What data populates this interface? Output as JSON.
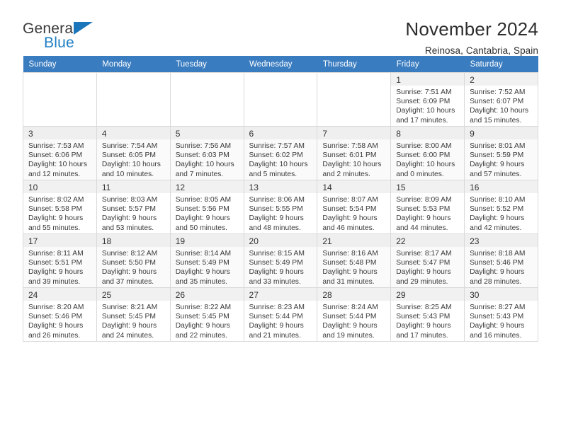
{
  "brand": {
    "name_part1": "General",
    "name_part2": "Blue",
    "accent_color": "#1b75bb"
  },
  "header": {
    "title": "November 2024",
    "subtitle": "Reinosa, Cantabria, Spain"
  },
  "calendar": {
    "header_bg": "#3a7cc0",
    "weekdays": [
      "Sunday",
      "Monday",
      "Tuesday",
      "Wednesday",
      "Thursday",
      "Friday",
      "Saturday"
    ],
    "weeks": [
      [
        {
          "day": "",
          "sunrise": "",
          "sunset": "",
          "daylight1": "",
          "daylight2": ""
        },
        {
          "day": "",
          "sunrise": "",
          "sunset": "",
          "daylight1": "",
          "daylight2": ""
        },
        {
          "day": "",
          "sunrise": "",
          "sunset": "",
          "daylight1": "",
          "daylight2": ""
        },
        {
          "day": "",
          "sunrise": "",
          "sunset": "",
          "daylight1": "",
          "daylight2": ""
        },
        {
          "day": "",
          "sunrise": "",
          "sunset": "",
          "daylight1": "",
          "daylight2": ""
        },
        {
          "day": "1",
          "sunrise": "Sunrise: 7:51 AM",
          "sunset": "Sunset: 6:09 PM",
          "daylight1": "Daylight: 10 hours",
          "daylight2": "and 17 minutes."
        },
        {
          "day": "2",
          "sunrise": "Sunrise: 7:52 AM",
          "sunset": "Sunset: 6:07 PM",
          "daylight1": "Daylight: 10 hours",
          "daylight2": "and 15 minutes."
        }
      ],
      [
        {
          "day": "3",
          "sunrise": "Sunrise: 7:53 AM",
          "sunset": "Sunset: 6:06 PM",
          "daylight1": "Daylight: 10 hours",
          "daylight2": "and 12 minutes."
        },
        {
          "day": "4",
          "sunrise": "Sunrise: 7:54 AM",
          "sunset": "Sunset: 6:05 PM",
          "daylight1": "Daylight: 10 hours",
          "daylight2": "and 10 minutes."
        },
        {
          "day": "5",
          "sunrise": "Sunrise: 7:56 AM",
          "sunset": "Sunset: 6:03 PM",
          "daylight1": "Daylight: 10 hours",
          "daylight2": "and 7 minutes."
        },
        {
          "day": "6",
          "sunrise": "Sunrise: 7:57 AM",
          "sunset": "Sunset: 6:02 PM",
          "daylight1": "Daylight: 10 hours",
          "daylight2": "and 5 minutes."
        },
        {
          "day": "7",
          "sunrise": "Sunrise: 7:58 AM",
          "sunset": "Sunset: 6:01 PM",
          "daylight1": "Daylight: 10 hours",
          "daylight2": "and 2 minutes."
        },
        {
          "day": "8",
          "sunrise": "Sunrise: 8:00 AM",
          "sunset": "Sunset: 6:00 PM",
          "daylight1": "Daylight: 10 hours",
          "daylight2": "and 0 minutes."
        },
        {
          "day": "9",
          "sunrise": "Sunrise: 8:01 AM",
          "sunset": "Sunset: 5:59 PM",
          "daylight1": "Daylight: 9 hours",
          "daylight2": "and 57 minutes."
        }
      ],
      [
        {
          "day": "10",
          "sunrise": "Sunrise: 8:02 AM",
          "sunset": "Sunset: 5:58 PM",
          "daylight1": "Daylight: 9 hours",
          "daylight2": "and 55 minutes."
        },
        {
          "day": "11",
          "sunrise": "Sunrise: 8:03 AM",
          "sunset": "Sunset: 5:57 PM",
          "daylight1": "Daylight: 9 hours",
          "daylight2": "and 53 minutes."
        },
        {
          "day": "12",
          "sunrise": "Sunrise: 8:05 AM",
          "sunset": "Sunset: 5:56 PM",
          "daylight1": "Daylight: 9 hours",
          "daylight2": "and 50 minutes."
        },
        {
          "day": "13",
          "sunrise": "Sunrise: 8:06 AM",
          "sunset": "Sunset: 5:55 PM",
          "daylight1": "Daylight: 9 hours",
          "daylight2": "and 48 minutes."
        },
        {
          "day": "14",
          "sunrise": "Sunrise: 8:07 AM",
          "sunset": "Sunset: 5:54 PM",
          "daylight1": "Daylight: 9 hours",
          "daylight2": "and 46 minutes."
        },
        {
          "day": "15",
          "sunrise": "Sunrise: 8:09 AM",
          "sunset": "Sunset: 5:53 PM",
          "daylight1": "Daylight: 9 hours",
          "daylight2": "and 44 minutes."
        },
        {
          "day": "16",
          "sunrise": "Sunrise: 8:10 AM",
          "sunset": "Sunset: 5:52 PM",
          "daylight1": "Daylight: 9 hours",
          "daylight2": "and 42 minutes."
        }
      ],
      [
        {
          "day": "17",
          "sunrise": "Sunrise: 8:11 AM",
          "sunset": "Sunset: 5:51 PM",
          "daylight1": "Daylight: 9 hours",
          "daylight2": "and 39 minutes."
        },
        {
          "day": "18",
          "sunrise": "Sunrise: 8:12 AM",
          "sunset": "Sunset: 5:50 PM",
          "daylight1": "Daylight: 9 hours",
          "daylight2": "and 37 minutes."
        },
        {
          "day": "19",
          "sunrise": "Sunrise: 8:14 AM",
          "sunset": "Sunset: 5:49 PM",
          "daylight1": "Daylight: 9 hours",
          "daylight2": "and 35 minutes."
        },
        {
          "day": "20",
          "sunrise": "Sunrise: 8:15 AM",
          "sunset": "Sunset: 5:49 PM",
          "daylight1": "Daylight: 9 hours",
          "daylight2": "and 33 minutes."
        },
        {
          "day": "21",
          "sunrise": "Sunrise: 8:16 AM",
          "sunset": "Sunset: 5:48 PM",
          "daylight1": "Daylight: 9 hours",
          "daylight2": "and 31 minutes."
        },
        {
          "day": "22",
          "sunrise": "Sunrise: 8:17 AM",
          "sunset": "Sunset: 5:47 PM",
          "daylight1": "Daylight: 9 hours",
          "daylight2": "and 29 minutes."
        },
        {
          "day": "23",
          "sunrise": "Sunrise: 8:18 AM",
          "sunset": "Sunset: 5:46 PM",
          "daylight1": "Daylight: 9 hours",
          "daylight2": "and 28 minutes."
        }
      ],
      [
        {
          "day": "24",
          "sunrise": "Sunrise: 8:20 AM",
          "sunset": "Sunset: 5:46 PM",
          "daylight1": "Daylight: 9 hours",
          "daylight2": "and 26 minutes."
        },
        {
          "day": "25",
          "sunrise": "Sunrise: 8:21 AM",
          "sunset": "Sunset: 5:45 PM",
          "daylight1": "Daylight: 9 hours",
          "daylight2": "and 24 minutes."
        },
        {
          "day": "26",
          "sunrise": "Sunrise: 8:22 AM",
          "sunset": "Sunset: 5:45 PM",
          "daylight1": "Daylight: 9 hours",
          "daylight2": "and 22 minutes."
        },
        {
          "day": "27",
          "sunrise": "Sunrise: 8:23 AM",
          "sunset": "Sunset: 5:44 PM",
          "daylight1": "Daylight: 9 hours",
          "daylight2": "and 21 minutes."
        },
        {
          "day": "28",
          "sunrise": "Sunrise: 8:24 AM",
          "sunset": "Sunset: 5:44 PM",
          "daylight1": "Daylight: 9 hours",
          "daylight2": "and 19 minutes."
        },
        {
          "day": "29",
          "sunrise": "Sunrise: 8:25 AM",
          "sunset": "Sunset: 5:43 PM",
          "daylight1": "Daylight: 9 hours",
          "daylight2": "and 17 minutes."
        },
        {
          "day": "30",
          "sunrise": "Sunrise: 8:27 AM",
          "sunset": "Sunset: 5:43 PM",
          "daylight1": "Daylight: 9 hours",
          "daylight2": "and 16 minutes."
        }
      ]
    ]
  }
}
